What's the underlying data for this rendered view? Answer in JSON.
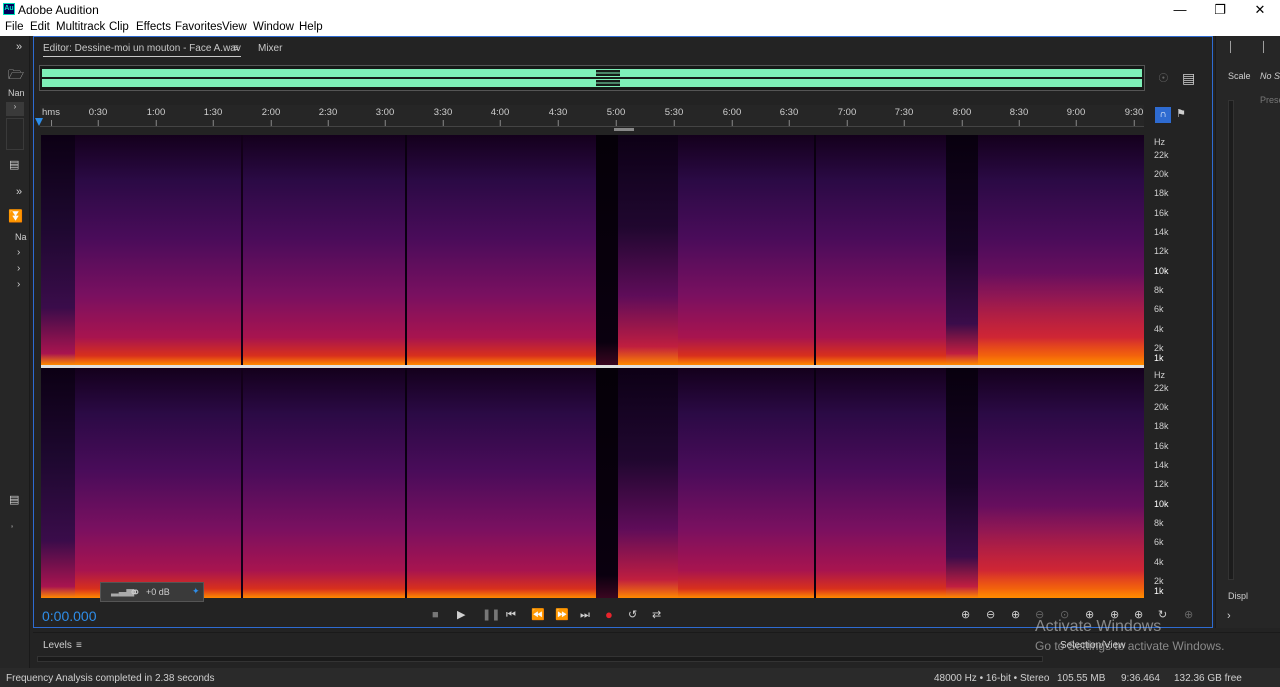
{
  "window": {
    "title": "Adobe Audition",
    "icon_text": "Au",
    "controls": [
      "minimize-icon",
      "maximize-icon",
      "close-icon"
    ]
  },
  "menu": [
    "File",
    "Edit",
    "Multitrack",
    "Clip",
    "Effects",
    "Favorites",
    "View",
    "Window",
    "Help"
  ],
  "left_panel": {
    "top_label": "Nan",
    "lower_label": "Na"
  },
  "editor": {
    "tab_label": "Editor: Dessine-moi un mouton - Face A.wav",
    "tab_menu_glyph": "≡",
    "mixer_label": "Mixer"
  },
  "ruler": {
    "ticks": [
      "hms",
      "0:30",
      "1:00",
      "1:30",
      "2:00",
      "2:30",
      "3:00",
      "3:30",
      "4:00",
      "4:30",
      "5:00",
      "5:30",
      "6:00",
      "6:30",
      "7:00",
      "7:30",
      "8:00",
      "8:30",
      "9:00",
      "9:30"
    ]
  },
  "hz_axis": {
    "unit": "Hz",
    "labels": [
      "22k",
      "20k",
      "18k",
      "16k",
      "14k",
      "12k",
      "10k",
      "8k",
      "6k",
      "4k",
      "2k",
      "1k"
    ],
    "strong": [
      "10k",
      "1k"
    ]
  },
  "hud": {
    "volume": "+0 dB"
  },
  "transport": {
    "time": "0:00.000",
    "buttons": [
      "stop-icon",
      "play-icon",
      "pause-icon",
      "skip-to-start-icon",
      "rewind-icon",
      "fast-forward-icon",
      "skip-to-end-icon",
      "record-icon",
      "loop-icon",
      "skip-selection-icon"
    ]
  },
  "right_panel": {
    "scale_label": "Scale",
    "no_selection": "No S",
    "preset_label": "Prese",
    "display_label": "Displ"
  },
  "levels_panel": {
    "label": "Levels",
    "menu_glyph": "≡"
  },
  "selection_view": "Selection/View",
  "watermark": {
    "line1": "Activate Windows",
    "line2": "Go to Settings to activate Windows."
  },
  "status": {
    "message": "Frequency Analysis completed in 2.38 seconds",
    "format": "48000 Hz • 16-bit • Stereo",
    "size": "105.55 MB",
    "duration": "9:36.464",
    "free": "132.36 GB free"
  },
  "colors": {
    "accent": "#2e8de8",
    "panel_border": "#2e6bd1",
    "waveform": "#7ef0b8",
    "record": "#e8242c"
  }
}
